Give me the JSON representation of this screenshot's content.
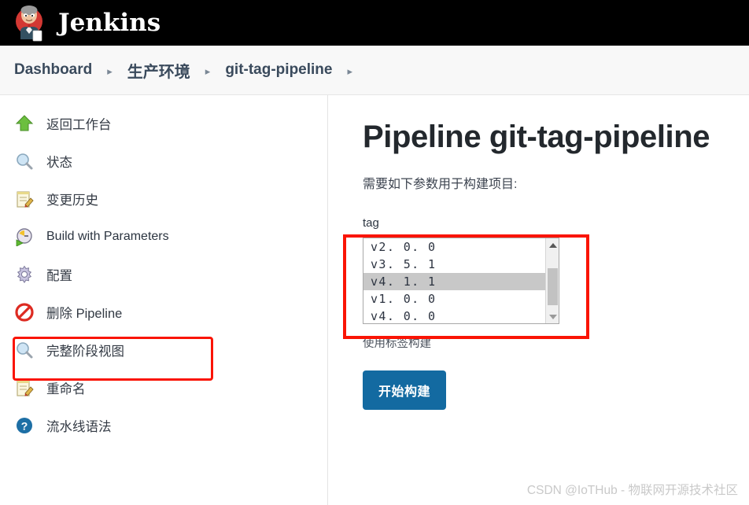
{
  "header": {
    "logo_icon": "jenkins-butler-logo",
    "title": "Jenkins"
  },
  "breadcrumb": {
    "separator": "▸",
    "items": [
      {
        "label": "Dashboard",
        "cjk": false
      },
      {
        "label": "生产环境",
        "cjk": true
      },
      {
        "label": "git-tag-pipeline",
        "cjk": false
      }
    ],
    "trailing_chevron": "▸"
  },
  "sidebar": {
    "items": [
      {
        "label": "返回工作台",
        "icon": "green-up-arrow-icon",
        "en": false,
        "highlighted": false
      },
      {
        "label": "状态",
        "icon": "magnifier-icon",
        "en": false,
        "highlighted": false
      },
      {
        "label": "变更历史",
        "icon": "notepad-pencil-icon",
        "en": false,
        "highlighted": false
      },
      {
        "label": "Build with Parameters",
        "icon": "clock-play-icon",
        "en": true,
        "highlighted": true
      },
      {
        "label": "配置",
        "icon": "gear-icon",
        "en": false,
        "highlighted": false
      },
      {
        "label": "删除 Pipeline",
        "icon": "no-entry-icon",
        "en": false,
        "highlighted": false
      },
      {
        "label": "完整阶段视图",
        "icon": "magnifier-icon",
        "en": false,
        "highlighted": false
      },
      {
        "label": "重命名",
        "icon": "notepad-pencil-icon",
        "en": false,
        "highlighted": false
      },
      {
        "label": "流水线语法",
        "icon": "help-question-icon",
        "en": false,
        "highlighted": false
      }
    ]
  },
  "main": {
    "page_title": "Pipeline git-tag-pipeline",
    "subtitle": "需要如下参数用于构建项目:",
    "param_label": "tag",
    "help_text": "使用标签构建",
    "build_button_label": "开始构建",
    "tag_options": [
      {
        "value": "v2. 0. 0",
        "selected": false
      },
      {
        "value": "v3. 5. 1",
        "selected": false
      },
      {
        "value": "v4. 1. 1",
        "selected": true
      },
      {
        "value": "v1. 0. 0",
        "selected": false
      },
      {
        "value": "v4. 0. 0",
        "selected": false
      }
    ],
    "selected_tag": "v4. 1. 1",
    "scrollbar": {
      "up_arrow_icon": "triangle-up-icon",
      "down_arrow_icon": "triangle-down-icon"
    }
  },
  "annotations": {
    "color": "#fa1405",
    "boxes": [
      "build-with-parameters",
      "tag-select"
    ]
  },
  "watermark": {
    "text": "CSDN @IoTHub - 物联网开源技术社区",
    "color": "#c9c9c9"
  }
}
